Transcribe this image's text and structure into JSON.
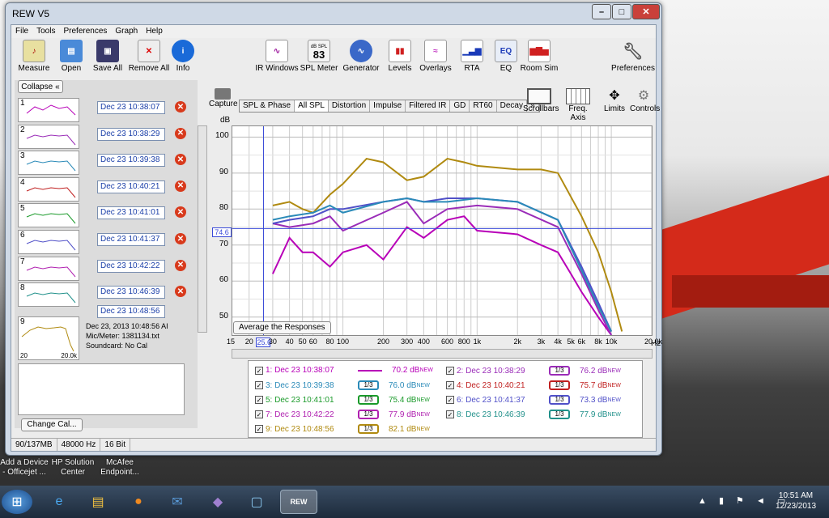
{
  "window": {
    "title": "REW V5"
  },
  "menu": [
    "File",
    "Tools",
    "Preferences",
    "Graph",
    "Help"
  ],
  "toolbar": [
    "Measure",
    "Open",
    "Save All",
    "Remove All",
    "Info",
    "IR Windows",
    "SPL Meter",
    "Generator",
    "Levels",
    "Overlays",
    "RTA",
    "EQ",
    "Room Sim",
    "Preferences"
  ],
  "spl_meter_value": "83",
  "spl_meter_unit": "dB SPL",
  "collapse_label": "Collapse",
  "measurements": [
    {
      "n": "1",
      "date": "Dec 23 10:38:07",
      "color": "#b800b8"
    },
    {
      "n": "2",
      "date": "Dec 23 10:38:29",
      "color": "#9a2cb8"
    },
    {
      "n": "3",
      "date": "Dec 23 10:39:38",
      "color": "#2a8ab8"
    },
    {
      "n": "4",
      "date": "Dec 23 10:40:21",
      "color": "#c02020"
    },
    {
      "n": "5",
      "date": "Dec 23 10:41:01",
      "color": "#1a9a2a"
    },
    {
      "n": "6",
      "date": "Dec 23 10:41:37",
      "color": "#5050c8"
    },
    {
      "n": "7",
      "date": "Dec 23 10:42:22",
      "color": "#b020b0"
    },
    {
      "n": "8",
      "date": "Dec 23 10:46:39",
      "color": "#20908a"
    },
    {
      "n": "9",
      "date": "Dec 23 10:48:56",
      "color": "#b08a10"
    }
  ],
  "info": {
    "line1": "Dec 23, 2013 10:48:56 AI",
    "line2": "Mic/Meter: 1381134.txt",
    "line3": "Soundcard: No Cal",
    "thumb_left": "20",
    "thumb_right": "20.0k"
  },
  "change_cal": "Change Cal...",
  "capture": "Capture",
  "tabs": [
    "SPL & Phase",
    "All SPL",
    "Distortion",
    "Impulse",
    "Filtered IR",
    "GD",
    "RT60",
    "Decay",
    "»"
  ],
  "right_tools": [
    "Scrollbars",
    "Freq. Axis",
    "Limits",
    "Controls"
  ],
  "yunit": "dB",
  "cursor_value": "74.6",
  "cursor_freq": "25.6",
  "avg_button": "Average the Responses",
  "xunit": "Hz",
  "legend": [
    {
      "label": "1: Dec 23 10:38:07",
      "value": "70.2 dB",
      "color": "#b800b8",
      "third": false
    },
    {
      "label": "2: Dec 23 10:38:29",
      "value": "76.2 dB",
      "color": "#9a2cb8",
      "third": true
    },
    {
      "label": "3: Dec 23 10:39:38",
      "value": "76.0 dB",
      "color": "#2a8ab8",
      "third": true
    },
    {
      "label": "4: Dec 23 10:40:21",
      "value": "75.7 dB",
      "color": "#c02020",
      "third": true
    },
    {
      "label": "5: Dec 23 10:41:01",
      "value": "75.4 dB",
      "color": "#1a9a2a",
      "third": true
    },
    {
      "label": "6: Dec 23 10:41:37",
      "value": "73.3 dB",
      "color": "#5050c8",
      "third": true
    },
    {
      "label": "7: Dec 23 10:42:22",
      "value": "77.9 dB",
      "color": "#b020b0",
      "third": true
    },
    {
      "label": "8: Dec 23 10:46:39",
      "value": "77.9 dB",
      "color": "#20908a",
      "third": true
    },
    {
      "label": "9: Dec 23 10:48:56",
      "value": "82.1 dB",
      "color": "#b08a10",
      "third": true
    }
  ],
  "new_tag": "NEW",
  "third_label": "1/3",
  "status": [
    "90/137MB",
    "48000 Hz",
    "16 Bit"
  ],
  "desktop_icons": [
    {
      "l1": "Add a Device",
      "l2": "- Officejet ..."
    },
    {
      "l1": "HP Solution",
      "l2": "Center"
    },
    {
      "l1": "McAfee",
      "l2": "Endpoint..."
    }
  ],
  "clock": {
    "time": "10:51 AM",
    "date": "12/23/2013"
  },
  "chart_data": {
    "type": "line",
    "xscale": "log",
    "xlim": [
      15,
      20000
    ],
    "ylim": [
      45,
      103
    ],
    "yticks": [
      50,
      60,
      70,
      80,
      90,
      100
    ],
    "xticks": [
      "15",
      "20",
      "25.6",
      "30",
      "40",
      "50",
      "60",
      "80",
      "100",
      "200",
      "300",
      "400",
      "600",
      "800",
      "1k",
      "2k",
      "3k",
      "4k",
      "5k",
      "6k",
      "8k",
      "10k",
      "20.0k"
    ],
    "series": [
      {
        "name": "1: Dec 23 10:38:07",
        "color": "#b800b8",
        "x": [
          30,
          40,
          50,
          60,
          80,
          100,
          150,
          200,
          300,
          400,
          600,
          800,
          1000,
          2000,
          3000,
          4000,
          5000,
          6000,
          8000,
          10000
        ],
        "y": [
          62,
          72,
          68,
          68,
          64,
          68,
          70,
          66,
          75,
          72,
          77,
          78,
          74,
          73,
          70,
          68,
          62,
          57,
          50,
          45
        ]
      },
      {
        "name": "2: Dec 23 10:38:29",
        "color": "#9a2cb8",
        "x": [
          30,
          40,
          60,
          80,
          100,
          200,
          300,
          400,
          600,
          1000,
          2000,
          4000,
          6000,
          8000,
          10000
        ],
        "y": [
          76,
          75,
          76,
          78,
          74,
          79,
          82,
          76,
          80,
          81,
          80,
          75,
          62,
          52,
          45
        ]
      },
      {
        "name": "9: Dec 23 10:48:56",
        "color": "#b08a10",
        "x": [
          30,
          40,
          50,
          60,
          80,
          100,
          150,
          200,
          300,
          400,
          600,
          800,
          1000,
          2000,
          3000,
          4000,
          6000,
          8000,
          10000,
          12000
        ],
        "y": [
          81,
          82,
          80,
          79,
          84,
          87,
          94,
          93,
          88,
          89,
          94,
          93,
          92,
          91,
          91,
          90,
          78,
          68,
          57,
          46
        ]
      },
      {
        "name": "6: Dec 23 10:41:37",
        "color": "#5050c8",
        "x": [
          30,
          40,
          60,
          80,
          100,
          200,
          300,
          400,
          600,
          1000,
          2000,
          4000,
          6000,
          8000,
          10000
        ],
        "y": [
          76,
          77,
          78,
          80,
          80,
          82,
          83,
          82,
          83,
          83,
          82,
          77,
          64,
          54,
          46
        ]
      },
      {
        "name": "3: Dec 23 10:39:38",
        "color": "#2a8ab8",
        "x": [
          30,
          40,
          60,
          80,
          100,
          200,
          300,
          400,
          600,
          1000,
          2000,
          4000,
          6000,
          8000,
          10000
        ],
        "y": [
          77,
          78,
          79,
          81,
          79,
          82,
          83,
          82,
          82,
          83,
          82,
          77,
          63,
          53,
          46
        ]
      }
    ]
  }
}
